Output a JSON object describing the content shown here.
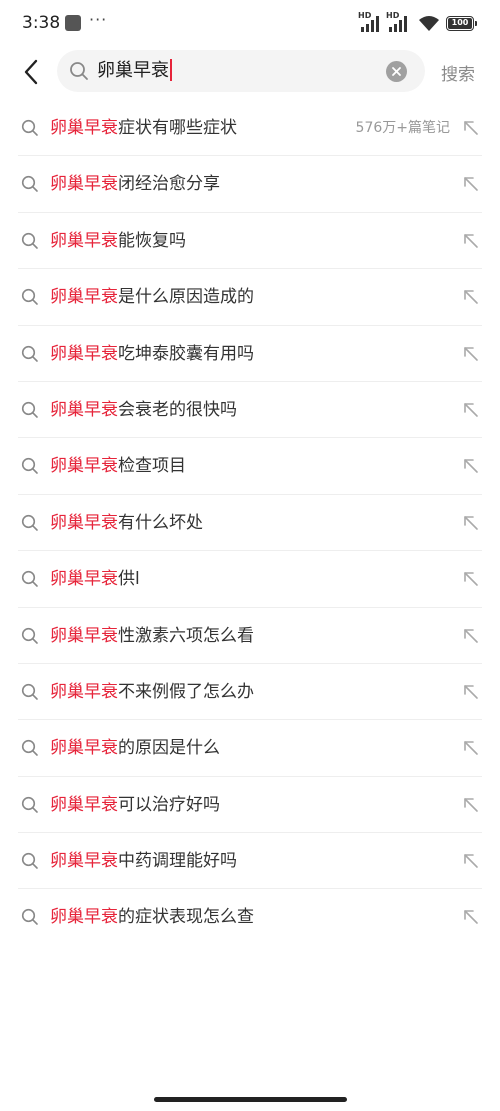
{
  "status_bar": {
    "time": "3:38",
    "more": "···",
    "sim1_label": "HD",
    "sim2_label": "HD",
    "battery_percent": 100,
    "battery_text": "100"
  },
  "header": {
    "search_value": "卵巢早衰",
    "search_button": "搜索"
  },
  "suggestions": [
    {
      "highlight": "卵巢早衰",
      "rest": "症状有哪些症状",
      "meta": "576万+篇笔记"
    },
    {
      "highlight": "卵巢早衰",
      "rest": "闭经治愈分享",
      "meta": ""
    },
    {
      "highlight": "卵巢早衰",
      "rest": "能恢复吗",
      "meta": ""
    },
    {
      "highlight": "卵巢早衰",
      "rest": "是什么原因造成的",
      "meta": ""
    },
    {
      "highlight": "卵巢早衰",
      "rest": "吃坤泰胶囊有用吗",
      "meta": ""
    },
    {
      "highlight": "卵巢早衰",
      "rest": "会衰老的很快吗",
      "meta": ""
    },
    {
      "highlight": "卵巢早衰",
      "rest": "检查项目",
      "meta": ""
    },
    {
      "highlight": "卵巢早衰",
      "rest": "有什么坏处",
      "meta": ""
    },
    {
      "highlight": "卵巢早衰",
      "rest": "供l",
      "meta": ""
    },
    {
      "highlight": "卵巢早衰",
      "rest": "性激素六项怎么看",
      "meta": ""
    },
    {
      "highlight": "卵巢早衰",
      "rest": "不来例假了怎么办",
      "meta": ""
    },
    {
      "highlight": "卵巢早衰",
      "rest": "的原因是什么",
      "meta": ""
    },
    {
      "highlight": "卵巢早衰",
      "rest": "可以治疗好吗",
      "meta": ""
    },
    {
      "highlight": "卵巢早衰",
      "rest": "中药调理能好吗",
      "meta": ""
    },
    {
      "highlight": "卵巢早衰",
      "rest": "的症状表现怎么查",
      "meta": ""
    }
  ],
  "colors": {
    "highlight": "#e6243a",
    "text": "#333333",
    "meta": "#999999",
    "search_button": "#8a8a8a"
  },
  "icons": {
    "back": "chevron-left-icon",
    "search": "search-icon",
    "clear": "clear-icon",
    "fill": "arrow-up-left-icon"
  }
}
